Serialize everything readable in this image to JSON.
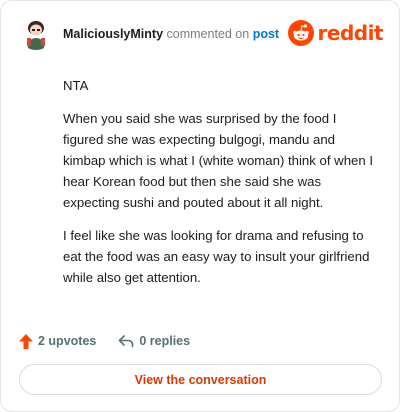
{
  "header": {
    "username": "MaliciouslyMinty",
    "commented_text": "commented on",
    "post_link": "post",
    "brand": "reddit"
  },
  "comment": {
    "paragraphs": [
      "NTA",
      "When you said she was surprised by the food I figured she was expecting bulgogi, mandu and kimbap which is what I (white woman) think of when I hear Korean food but then she said she was expecting sushi and pouted about it all night.",
      "I feel like she was looking for drama and refusing to eat the food was an easy way to insult your girlfriend while also get attention."
    ]
  },
  "stats": {
    "upvotes": "2 upvotes",
    "replies": "0 replies"
  },
  "cta": {
    "label": "View the conversation"
  },
  "colors": {
    "brand": "#ff4500",
    "link": "#0079d3",
    "cta_text": "#d93a00"
  },
  "icons": [
    "avatar",
    "reddit-logo-icon",
    "upvote-arrow-icon",
    "reply-arrow-icon"
  ]
}
